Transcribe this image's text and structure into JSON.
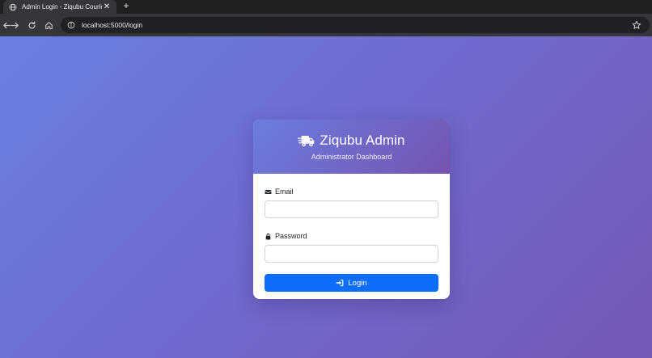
{
  "browser": {
    "tab": {
      "title": "Admin Login - Ziqubu Courier",
      "close_glyph": "✕",
      "favicon": "globe-icon"
    },
    "new_tab_glyph": "+",
    "address": "localhost:5000/login",
    "icons": {
      "back": "back-arrow-icon",
      "forward": "forward-arrow-icon",
      "reload": "reload-icon",
      "home": "home-icon",
      "info": "info-icon",
      "bookmark": "star-icon"
    }
  },
  "login_card": {
    "brand_title": "Ziqubu Admin",
    "brand_icon": "truck-fast-icon",
    "subtitle": "Administrator Dashboard",
    "email": {
      "label": "Email",
      "icon": "envelope-icon",
      "value": "",
      "placeholder": ""
    },
    "password": {
      "label": "Password",
      "icon": "lock-icon",
      "value": "",
      "placeholder": ""
    },
    "submit": {
      "label": "Login",
      "icon": "sign-in-icon"
    }
  },
  "colors": {
    "page_gradient_start": "#6a7fe3",
    "page_gradient_end": "#7658b5",
    "header_gradient_start": "#6b7ee0",
    "header_gradient_end": "#7654b0",
    "primary_button": "#0d6efd",
    "browser_chrome": "#35363a"
  }
}
